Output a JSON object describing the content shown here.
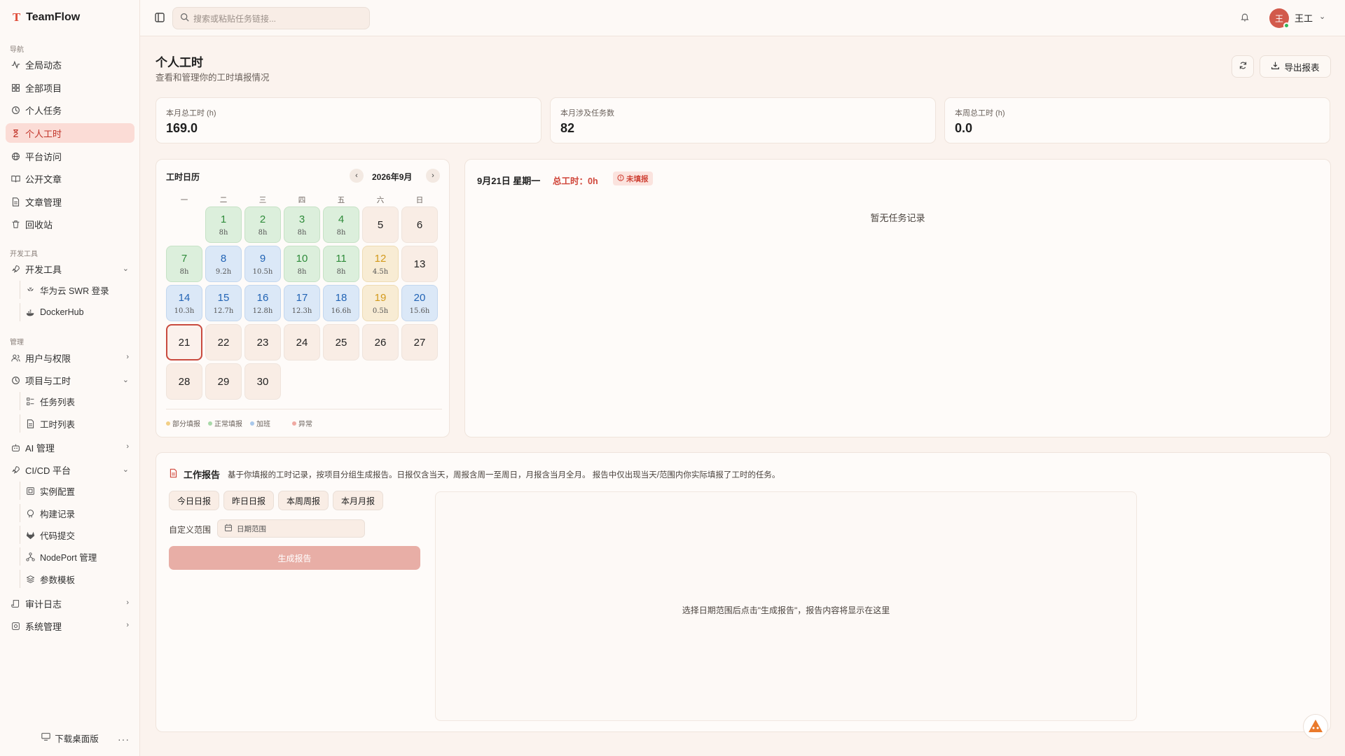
{
  "app": {
    "name": "TeamFlow",
    "logo_glyph": "T"
  },
  "sidebar": {
    "sections": {
      "nav": "导航",
      "dev": "开发工具",
      "admin": "管理"
    },
    "items": {
      "activity": "全局动态",
      "projects": "全部项目",
      "tasks": "个人任务",
      "timesheet": "个人工时",
      "platform": "平台访问",
      "articles": "公开文章",
      "article_mgmt": "文章管理",
      "trash": "回收站",
      "devtools": "开发工具",
      "huawei": "华为云 SWR 登录",
      "dockerhub": "DockerHub",
      "users": "用户与权限",
      "proj_hours": "项目与工时",
      "task_list": "任务列表",
      "hour_list": "工时列表",
      "ai": "AI 管理",
      "cicd": "CI/CD 平台",
      "instances": "实例配置",
      "builds": "构建记录",
      "commits": "代码提交",
      "nodeport": "NodePort 管理",
      "params": "参数模板",
      "audit": "审计日志",
      "system": "系统管理"
    },
    "download": "下载桌面版",
    "more": "···"
  },
  "header": {
    "search_placeholder": "搜索或粘贴任务链接...",
    "user_initial": "王",
    "user_name": "王工"
  },
  "page": {
    "title": "个人工时",
    "subtitle": "查看和管理你的工时填报情况",
    "export": "导出报表"
  },
  "stats": [
    {
      "label": "本月总工时 (h)",
      "value": "169.0"
    },
    {
      "label": "本月涉及任务数",
      "value": "82"
    },
    {
      "label": "本周总工时 (h)",
      "value": "0.0"
    }
  ],
  "calendar": {
    "title": "工时日历",
    "month": "2026年9月",
    "weekdays": [
      "一",
      "二",
      "三",
      "四",
      "五",
      "六",
      "日"
    ],
    "days": [
      {
        "d": "1",
        "h": "8h",
        "s": "green"
      },
      {
        "d": "2",
        "h": "8h",
        "s": "green"
      },
      {
        "d": "3",
        "h": "8h",
        "s": "green"
      },
      {
        "d": "4",
        "h": "8h",
        "s": "green"
      },
      {
        "d": "5",
        "h": "",
        "s": ""
      },
      {
        "d": "6",
        "h": "",
        "s": ""
      },
      {
        "d": "7",
        "h": "8h",
        "s": "green"
      },
      {
        "d": "8",
        "h": "9.2h",
        "s": "blue"
      },
      {
        "d": "9",
        "h": "10.5h",
        "s": "blue"
      },
      {
        "d": "10",
        "h": "8h",
        "s": "green"
      },
      {
        "d": "11",
        "h": "8h",
        "s": "green"
      },
      {
        "d": "12",
        "h": "4.5h",
        "s": "yellow"
      },
      {
        "d": "13",
        "h": "",
        "s": ""
      },
      {
        "d": "14",
        "h": "10.3h",
        "s": "blue"
      },
      {
        "d": "15",
        "h": "12.7h",
        "s": "blue"
      },
      {
        "d": "16",
        "h": "12.8h",
        "s": "blue"
      },
      {
        "d": "17",
        "h": "12.3h",
        "s": "blue"
      },
      {
        "d": "18",
        "h": "16.6h",
        "s": "blue"
      },
      {
        "d": "19",
        "h": "0.5h",
        "s": "yellow"
      },
      {
        "d": "20",
        "h": "15.6h",
        "s": "blue"
      },
      {
        "d": "21",
        "h": "",
        "s": "today"
      },
      {
        "d": "22",
        "h": "",
        "s": ""
      },
      {
        "d": "23",
        "h": "",
        "s": ""
      },
      {
        "d": "24",
        "h": "",
        "s": ""
      },
      {
        "d": "25",
        "h": "",
        "s": ""
      },
      {
        "d": "26",
        "h": "",
        "s": ""
      },
      {
        "d": "27",
        "h": "",
        "s": ""
      },
      {
        "d": "28",
        "h": "",
        "s": ""
      },
      {
        "d": "29",
        "h": "",
        "s": ""
      },
      {
        "d": "30",
        "h": "",
        "s": ""
      }
    ],
    "first_weekday_offset": 1,
    "legend": [
      {
        "label": "部分填报",
        "color": "#f2cf86"
      },
      {
        "label": "正常填报",
        "color": "#a9d9a9"
      },
      {
        "label": "加班",
        "color": "#a9c8ea"
      },
      {
        "label": "异常",
        "color": "#f0a9a2"
      }
    ]
  },
  "detail": {
    "date": "9月21日 星期一",
    "total": "总工时：0h",
    "badge": "未填报",
    "empty": "暂无任务记录"
  },
  "report": {
    "title": "工作报告",
    "desc": "基于你填报的工时记录，按项目分组生成报告。日报仅含当天，周报含周一至周日，月报含当月全月。 报告中仅出现当天/范围内你实际填报了工时的任务。",
    "buttons": [
      "今日日报",
      "昨日日报",
      "本周周报",
      "本月月报"
    ],
    "range_label": "自定义范围",
    "range_placeholder": "日期范围",
    "generate": "生成报告",
    "output_hint": "选择日期范围后点击\"生成报告\"，报告内容将显示在这里"
  },
  "colors": {
    "accent": "#c94a3e",
    "active_bg": "#fbdcd6",
    "page_bg": "#fbf3ee"
  }
}
